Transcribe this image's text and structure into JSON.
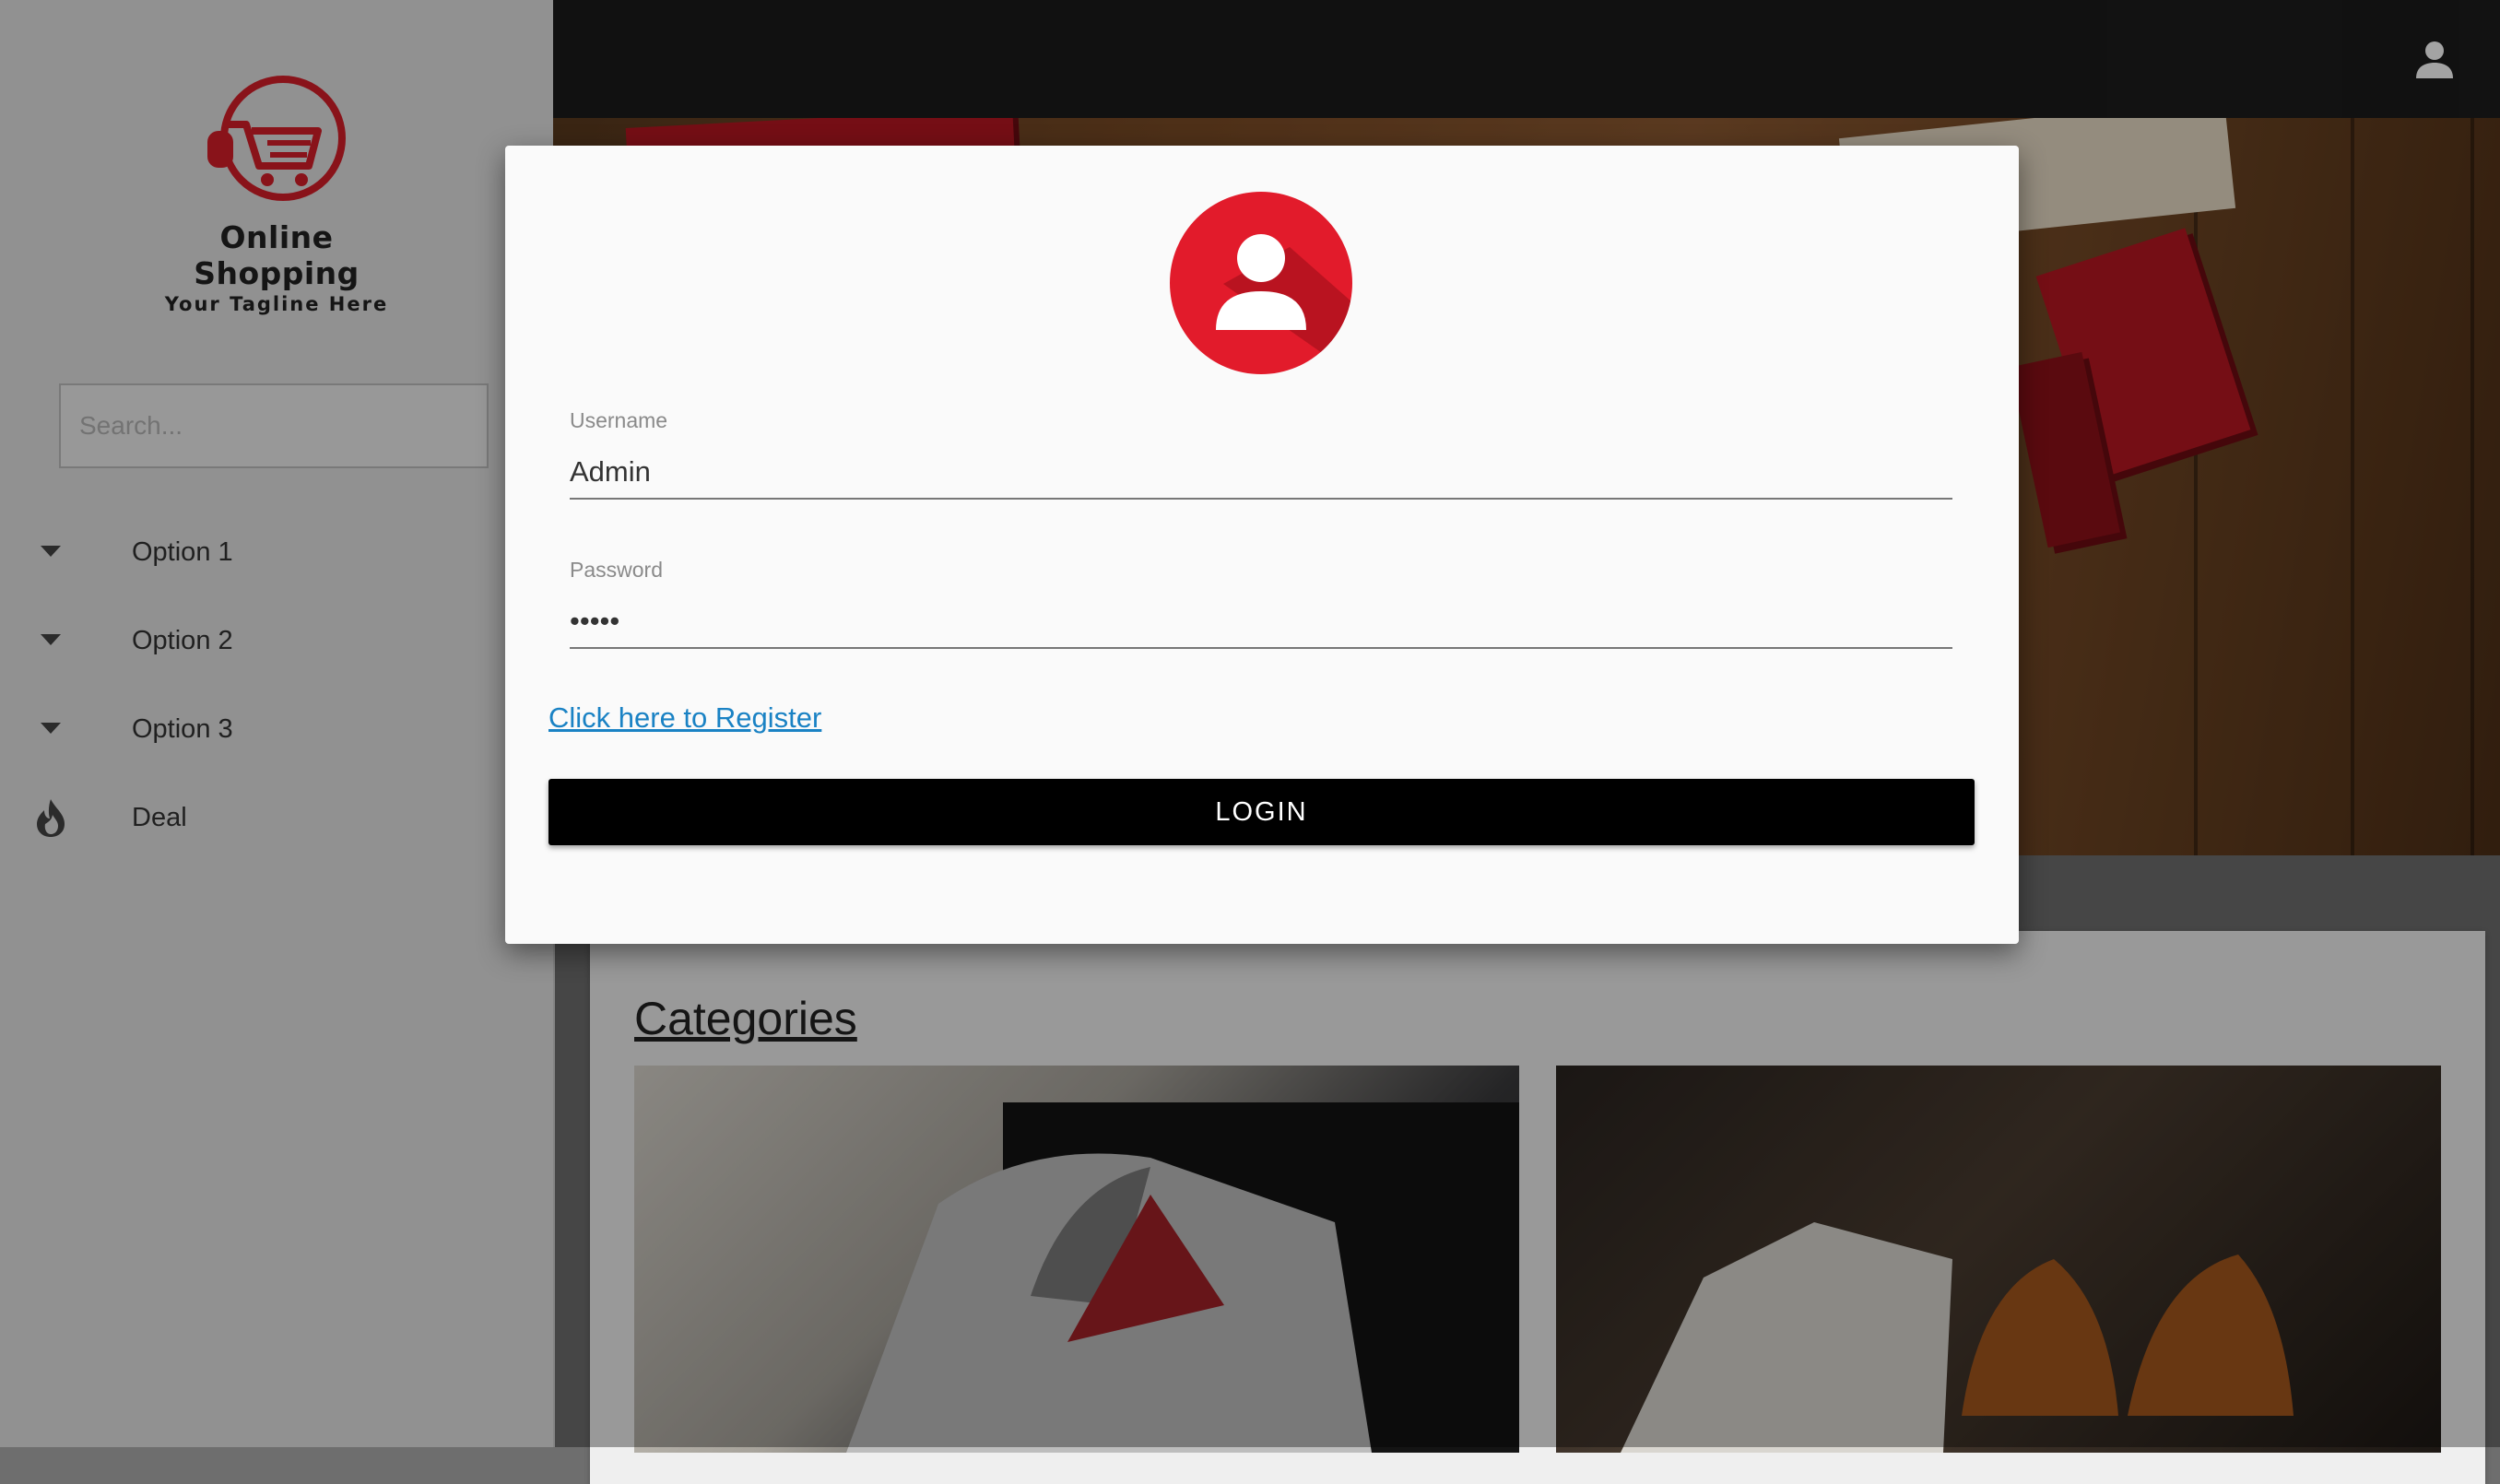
{
  "brand": {
    "name": "Online Shopping",
    "tagline": "Your Tagline Here",
    "color": "#d71f29"
  },
  "search": {
    "placeholder": "Search..."
  },
  "sidebar": {
    "items": [
      {
        "label": "Option 1",
        "icon": "caret-down-icon"
      },
      {
        "label": "Option 2",
        "icon": "caret-down-icon"
      },
      {
        "label": "Option 3",
        "icon": "caret-down-icon"
      },
      {
        "label": "Deal",
        "icon": "fire-icon"
      }
    ]
  },
  "topbar": {
    "icon": "user-icon"
  },
  "main": {
    "categories_title": "Categories"
  },
  "login_modal": {
    "avatar_icon": "user-avatar-icon",
    "username_label": "Username",
    "username_value": "Admin",
    "password_label": "Password",
    "password_value": "•••••",
    "register_link": "Click here to Register",
    "login_button": "LOGIN",
    "accent_color": "#e21b2b"
  }
}
